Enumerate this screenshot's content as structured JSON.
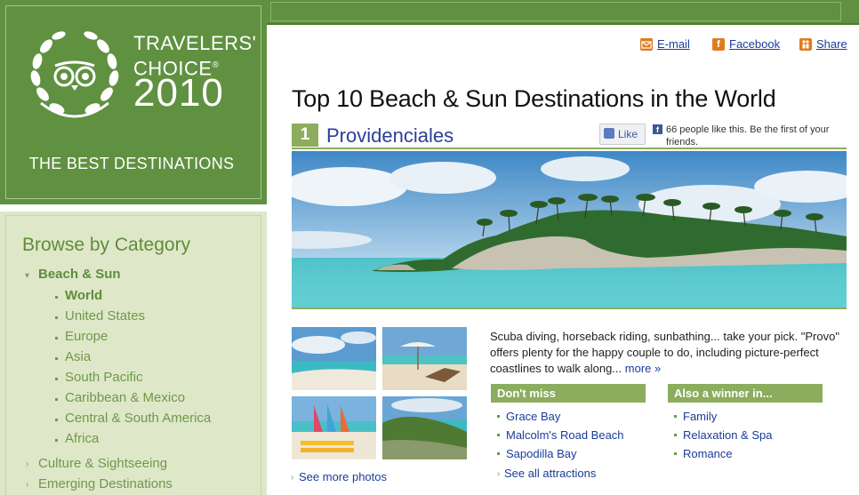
{
  "badge": {
    "line1": "TRAVELERS'",
    "line2": "CHOICE",
    "registered": "®",
    "year": "2010",
    "subtitle": "THE BEST DESTINATIONS"
  },
  "sidebar": {
    "title": "Browse by Category",
    "categories": [
      {
        "label": "Beach & Sun",
        "expanded": true
      },
      {
        "label": "Culture & Sightseeing",
        "expanded": false
      },
      {
        "label": "Emerging Destinations",
        "expanded": false
      }
    ],
    "subcategories": [
      "World",
      "United States",
      "Europe",
      "Asia",
      "South Pacific",
      "Caribbean & Mexico",
      "Central & South America",
      "Africa"
    ],
    "active_sub": "World"
  },
  "share": {
    "email": "E-mail",
    "facebook": "Facebook",
    "share": "Share"
  },
  "page_title": "Top 10 Beach & Sun Destinations in the World",
  "entry": {
    "rank": "1",
    "name": "Providenciales",
    "like_label": "Like",
    "like_text": "66 people like this. Be the first of your friends.",
    "description": "Scuba diving, horseback riding, sunbathing... take your pick. \"Provo\" offers plenty for the happy couple to do, including picture-perfect coastlines to walk along...",
    "more_label": "more »",
    "see_more_photos": "See more photos",
    "dont_miss": {
      "heading": "Don't miss",
      "items": [
        "Grace Bay",
        "Malcolm's Road Beach",
        "Sapodilla Bay"
      ],
      "see_all": "See all attractions"
    },
    "winner": {
      "heading": "Also a winner in...",
      "items": [
        "Family",
        "Relaxation & Spa",
        "Romance"
      ]
    }
  },
  "colors": {
    "brand_green": "#5f9140",
    "accent_green": "#8bad5d",
    "link_blue": "#1a3c9a",
    "sidebar_bg": "#dfe7c9"
  },
  "icons": {
    "email": "email-icon",
    "facebook": "facebook-icon",
    "share": "share-icon",
    "owl": "tripadvisor-owl-icon"
  }
}
